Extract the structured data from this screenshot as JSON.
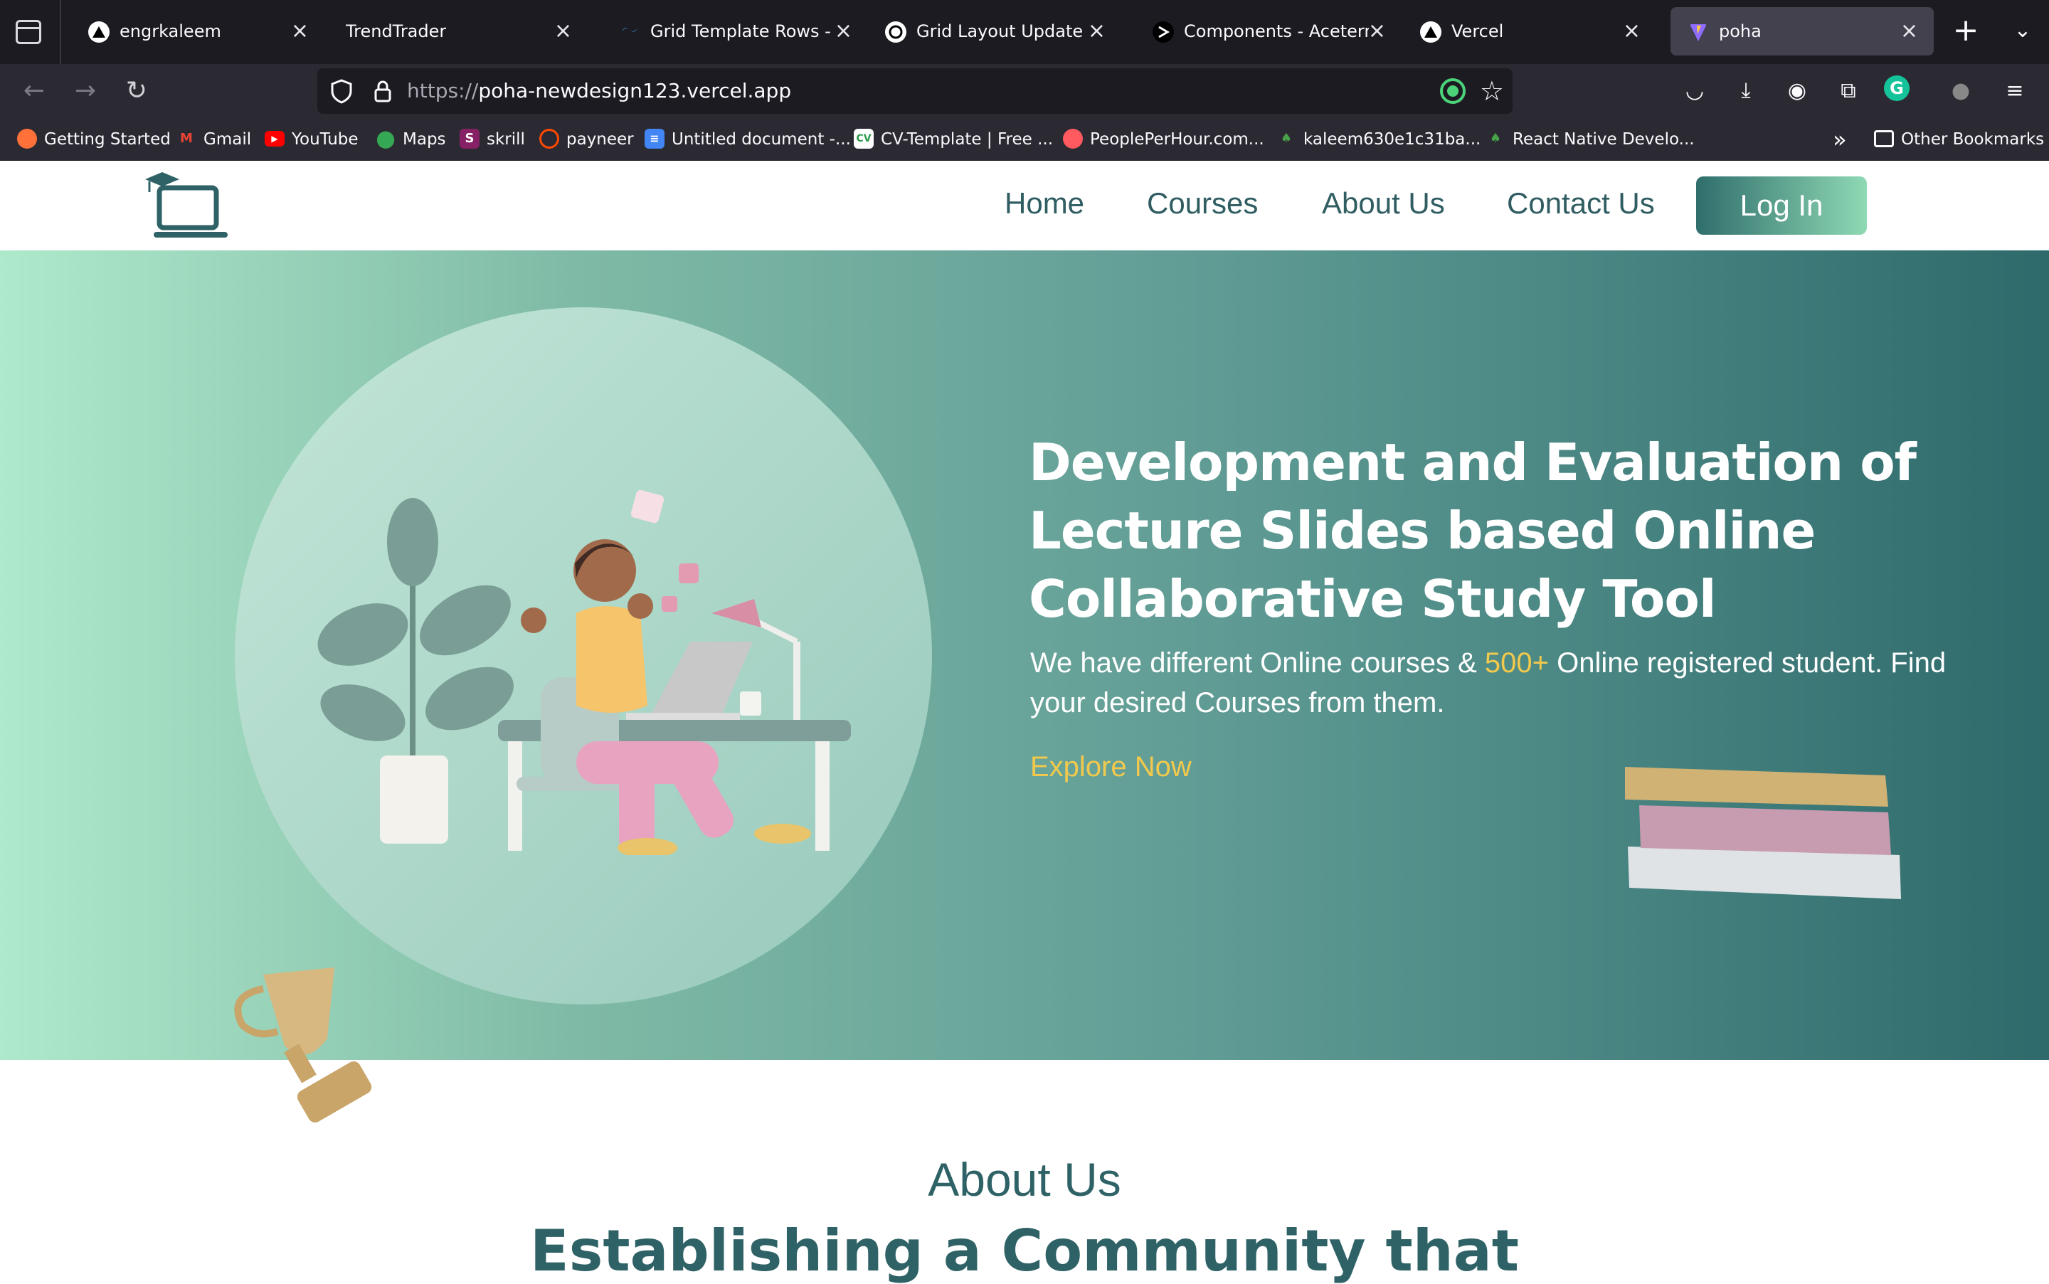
{
  "browser": {
    "tabs": [
      {
        "label": "engrkaleem",
        "favicon": "vercel-triangle-icon",
        "active": false
      },
      {
        "label": "TrendTrader",
        "favicon": "",
        "active": false
      },
      {
        "label": "Grid Template Rows - Tai",
        "favicon": "tailwind-icon",
        "active": false
      },
      {
        "label": "Grid Layout Update",
        "favicon": "openai-icon",
        "active": false
      },
      {
        "label": "Components - Aceternity",
        "favicon": "aceternity-icon",
        "active": false
      },
      {
        "label": "Vercel",
        "favicon": "vercel-triangle-icon",
        "active": false
      },
      {
        "label": "poha",
        "favicon": "vite-icon",
        "active": true
      }
    ],
    "url_protocol": "https://",
    "url_host": "poha-newdesign123.vercel.app",
    "bookmarks": [
      {
        "label": "Getting Started",
        "icon": "firefox-icon",
        "color": "#ff7139"
      },
      {
        "label": "Gmail",
        "icon": "gmail-icon",
        "color": "#ea4335"
      },
      {
        "label": "YouTube",
        "icon": "youtube-icon",
        "color": "#ff0000"
      },
      {
        "label": "Maps",
        "icon": "maps-icon",
        "color": "#34a853"
      },
      {
        "label": "skrill",
        "icon": "skrill-icon",
        "color": "#862165"
      },
      {
        "label": "payneer",
        "icon": "payoneer-icon",
        "color": "#ff4800"
      },
      {
        "label": "Untitled document -...",
        "icon": "docs-icon",
        "color": "#4285f4"
      },
      {
        "label": "CV-Template | Free ...",
        "icon": "cv-icon",
        "color": "#ffffff"
      },
      {
        "label": "PeoplePerHour.com...",
        "icon": "pph-icon",
        "color": "#ff5a5f"
      },
      {
        "label": "kaleem630e1c31ba...",
        "icon": "mongodb-icon",
        "color": "#47a248"
      },
      {
        "label": "React Native Develo...",
        "icon": "mongodb-icon",
        "color": "#47a248"
      }
    ],
    "other_bookmarks": "Other Bookmarks"
  },
  "site": {
    "nav": {
      "home": "Home",
      "courses": "Courses",
      "about": "About Us",
      "contact": "Contact Us",
      "login": "Log In"
    },
    "hero": {
      "title": "Development and Evaluation of Lecture Slides based Online Collaborative Study Tool",
      "desc_part1": "We have different Online courses & ",
      "desc_highlight": "500+",
      "desc_part2": " Online registered student. Find your desired Courses from them.",
      "cta": "Explore Now"
    },
    "about": {
      "label": "About Us",
      "heading": "Establishing a Community that"
    }
  },
  "colors": {
    "brand_teal": "#2f6266",
    "accent_yellow": "#f2c94c",
    "hero_gradient_start": "#afe9cb",
    "hero_gradient_end": "#2e6a6b"
  }
}
